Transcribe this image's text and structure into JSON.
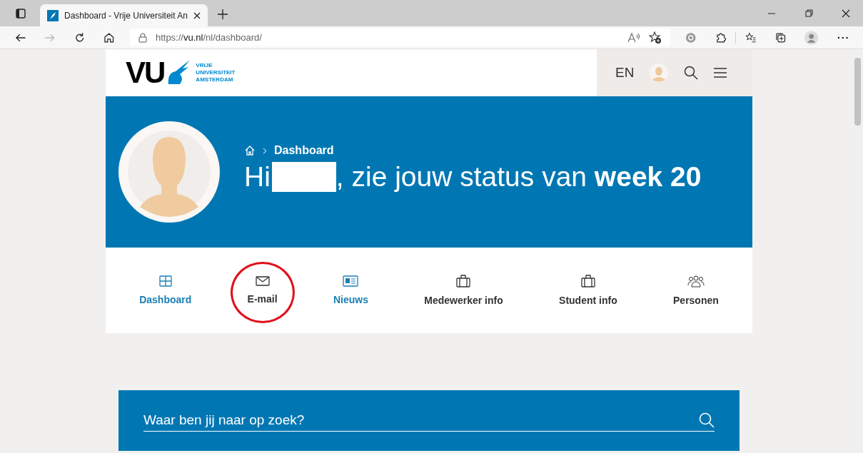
{
  "browser": {
    "tab_title": "Dashboard - Vrije Universiteit An",
    "url_prefix": "https://",
    "url_host": "vu.nl",
    "url_path": "/nl/dashboard/"
  },
  "header": {
    "logo_mark": "VU",
    "logo_lines": [
      "VRIJE",
      "UNIVERSITEIT",
      "AMSTERDAM"
    ],
    "language": "EN"
  },
  "hero": {
    "breadcrumb": "Dashboard",
    "greeting_start": "Hi",
    "greeting_end": ", zie jouw status van **week 20**"
  },
  "nav": [
    {
      "label": "Dashboard",
      "accent": true,
      "circled": false
    },
    {
      "label": "E-mail",
      "accent": false,
      "circled": true
    },
    {
      "label": "Nieuws",
      "accent": true,
      "circled": false
    },
    {
      "label": "Medewerker info",
      "accent": false,
      "circled": false
    },
    {
      "label": "Student info",
      "accent": false,
      "circled": false
    },
    {
      "label": "Personen",
      "accent": false,
      "circled": false
    }
  ],
  "search": {
    "placeholder": "Waar ben jij naar op zoek?"
  }
}
